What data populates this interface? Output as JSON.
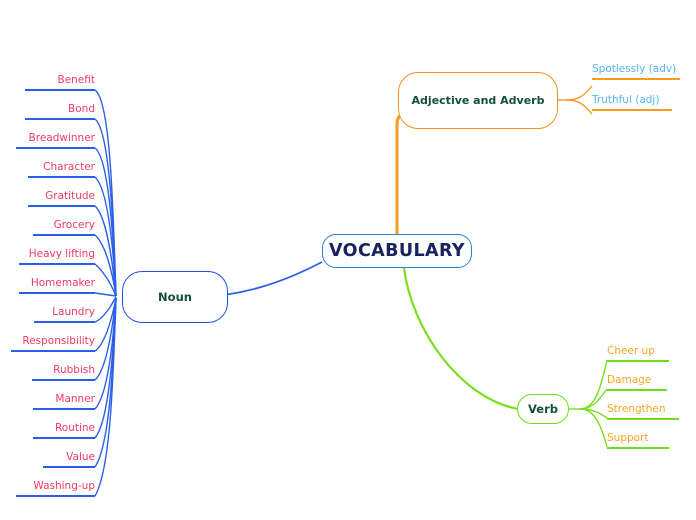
{
  "map": {
    "central": {
      "label": "VOCABULARY",
      "color": "#19215e",
      "border_color": "#2f7fd0"
    },
    "branches": [
      {
        "id": "noun",
        "label": "Noun",
        "edge_color": "#2b5fe8",
        "leaf_text_color": "#ef3a63",
        "leaves": [
          {
            "label": "Benefit"
          },
          {
            "label": "Bond"
          },
          {
            "label": "Breadwinner"
          },
          {
            "label": "Character"
          },
          {
            "label": "Gratitude"
          },
          {
            "label": "Grocery"
          },
          {
            "label": "Heavy lifting"
          },
          {
            "label": "Homemaker"
          },
          {
            "label": "Laundry"
          },
          {
            "label": "Responsibility"
          },
          {
            "label": "Rubbish"
          },
          {
            "label": "Manner"
          },
          {
            "label": "Routine"
          },
          {
            "label": "Value"
          },
          {
            "label": "Washing-up"
          }
        ]
      },
      {
        "id": "adjective-and-adverb",
        "label": "Adjective and Adverb",
        "edge_color": "#f79a1e",
        "leaf_text_color": "#55b4ec",
        "leaves": [
          {
            "label": "Spotlessly  (adv)"
          },
          {
            "label": "Truthful (adj)"
          }
        ]
      },
      {
        "id": "verb",
        "label": "Verb",
        "edge_color": "#6ede16",
        "leaf_text_color": "#f5a623",
        "leaves": [
          {
            "label": "Cheer up"
          },
          {
            "label": "Damage"
          },
          {
            "label": "Strengthen"
          },
          {
            "label": "Support"
          }
        ]
      }
    ]
  }
}
